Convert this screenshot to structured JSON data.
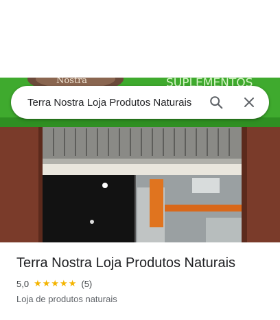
{
  "search": {
    "query": "Terra Nostra Loja Produtos Naturais",
    "search_icon": "search-icon",
    "close_icon": "close-icon"
  },
  "photo": {
    "sign_text_left": "Nostra",
    "sign_text_right": "SUPLEMENTOS",
    "colors": {
      "sign_green": "#3faa2e",
      "wall_brown": "#7a3b2a",
      "shutter_gray": "#8a8a86",
      "interior_dark": "#1a1a1a"
    }
  },
  "place": {
    "title": "Terra Nostra Loja Produtos Naturais",
    "rating": "5,0",
    "stars": 5,
    "review_count": "(5)",
    "category": "Loja de produtos naturais"
  },
  "colors": {
    "star": "#f4b400",
    "title_text": "#202124",
    "secondary_text": "#5f6368"
  }
}
